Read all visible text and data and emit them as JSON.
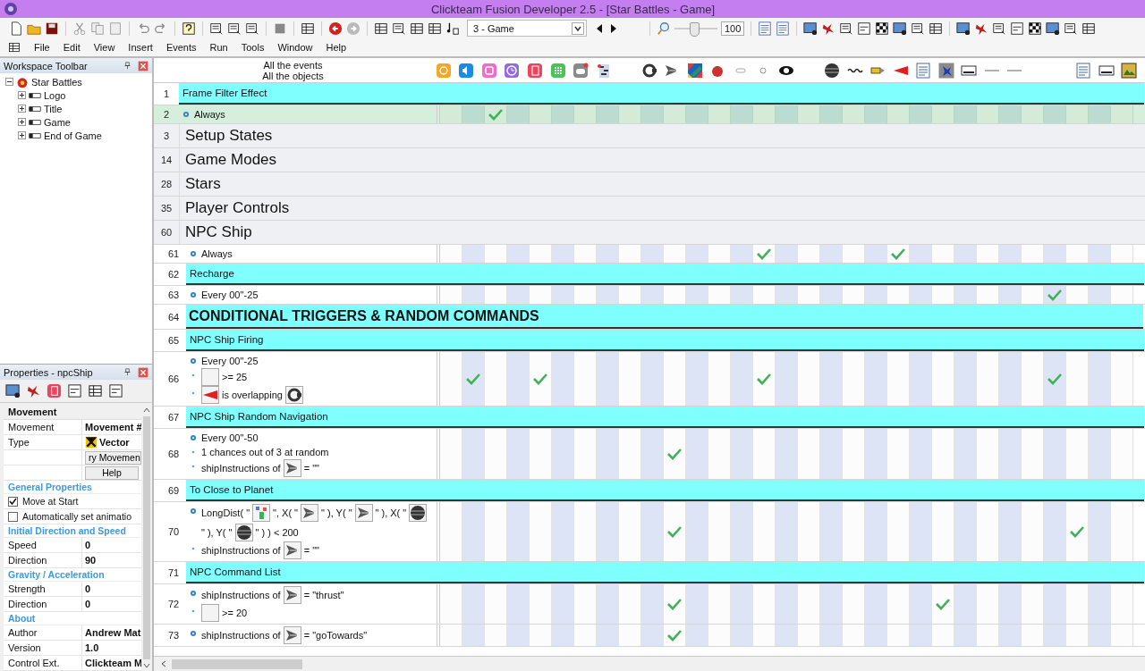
{
  "window": {
    "title": "Clickteam Fusion Developer 2.5 - [Star Battles - Game]"
  },
  "toolbar": {
    "frame_select": "3 - Game",
    "zoom_slider": {
      "level": 0.45
    },
    "zoom_value": "100"
  },
  "menu": [
    "File",
    "Edit",
    "View",
    "Insert",
    "Events",
    "Run",
    "Tools",
    "Window",
    "Help"
  ],
  "workspace": {
    "title": "Workspace Toolbar",
    "tree": [
      {
        "label": "Star Battles",
        "expanded": true,
        "children": [
          {
            "label": "Logo",
            "expanded": false
          },
          {
            "label": "Title",
            "expanded": false
          },
          {
            "label": "Game",
            "expanded": false
          },
          {
            "label": "End of Game",
            "expanded": false
          }
        ]
      }
    ]
  },
  "properties": {
    "title": "Properties - npcShip",
    "rows": [
      {
        "kind": "category",
        "name": "Movement"
      },
      {
        "kind": "prop",
        "name": "Movement",
        "value": "Movement #"
      },
      {
        "kind": "prop_icon",
        "name": "Type",
        "value": "Vector"
      },
      {
        "kind": "button",
        "value": "ry Movemen"
      },
      {
        "kind": "button",
        "value": "Help"
      },
      {
        "kind": "heading",
        "name": "General Properties"
      },
      {
        "kind": "checkbox",
        "name": "Move at Start",
        "checked": true
      },
      {
        "kind": "checkbox",
        "name": "Automatically set animatio",
        "checked": false
      },
      {
        "kind": "heading",
        "name": "Initial Direction and Speed"
      },
      {
        "kind": "prop",
        "name": "Speed",
        "value": "0"
      },
      {
        "kind": "prop",
        "name": "Direction",
        "value": "90"
      },
      {
        "kind": "heading",
        "name": "Gravity / Acceleration"
      },
      {
        "kind": "prop",
        "name": "Strength",
        "value": "0"
      },
      {
        "kind": "prop",
        "name": "Direction",
        "value": "0"
      },
      {
        "kind": "heading",
        "name": "About"
      },
      {
        "kind": "prop",
        "name": "Author",
        "value": "Andrew Mat"
      },
      {
        "kind": "prop",
        "name": "Version",
        "value": "1.0"
      },
      {
        "kind": "prop",
        "name": "Control Ext.",
        "value": "Clickteam M"
      }
    ]
  },
  "editor": {
    "header": [
      "All the events",
      "All the objects"
    ],
    "rows": [
      {
        "kind": "group",
        "number": "1",
        "title": "Frame Filter Effect",
        "selected": false
      },
      {
        "kind": "event",
        "number": "2",
        "selected": true,
        "conditions": [
          {
            "parts": [
              {
                "kind": "text",
                "text": "Always"
              }
            ]
          }
        ],
        "checked": [
          false,
          false,
          true,
          false,
          false,
          false,
          false,
          false,
          false,
          false,
          false,
          false,
          false,
          false,
          false,
          false,
          false,
          false,
          false,
          false,
          false,
          false,
          false,
          false,
          false,
          false,
          false,
          false,
          false,
          false,
          false
        ]
      },
      {
        "kind": "section",
        "number": "3",
        "title": "Setup States",
        "selected": false
      },
      {
        "kind": "section",
        "number": "14",
        "title": "Game Modes",
        "selected": false
      },
      {
        "kind": "section",
        "number": "28",
        "title": "Stars",
        "selected": false
      },
      {
        "kind": "section",
        "number": "35",
        "title": "Player Controls",
        "selected": false
      },
      {
        "kind": "section",
        "number": "60",
        "title": "NPC Ship",
        "selected": false,
        "children": [
          {
            "kind": "event",
            "number": "61",
            "selected": false,
            "conditions": [
              {
                "parts": [
                  {
                    "kind": "text",
                    "text": "Always"
                  }
                ]
              }
            ],
            "checked": [
              false,
              false,
              false,
              false,
              false,
              false,
              false,
              false,
              false,
              false,
              false,
              false,
              false,
              false,
              true,
              false,
              false,
              false,
              false,
              false,
              true,
              false,
              false,
              false,
              false,
              false,
              false,
              false,
              false,
              false,
              false
            ]
          },
          {
            "kind": "group",
            "number": "62",
            "title": "Recharge",
            "selected": false
          },
          {
            "kind": "event",
            "number": "63",
            "selected": false,
            "conditions": [
              {
                "parts": [
                  {
                    "kind": "text",
                    "text": "Every 00''-25"
                  }
                ]
              }
            ],
            "checked": [
              false,
              false,
              false,
              false,
              false,
              false,
              false,
              false,
              false,
              false,
              false,
              false,
              false,
              false,
              false,
              false,
              false,
              false,
              false,
              false,
              false,
              false,
              false,
              false,
              false,
              false,
              false,
              true,
              false,
              false,
              false
            ]
          },
          {
            "kind": "title",
            "number": "64",
            "title": "CONDITIONAL TRIGGERS & RANDOM COMMANDS",
            "selected": false
          },
          {
            "kind": "group",
            "number": "65",
            "title": "NPC Ship Firing",
            "selected": false
          },
          {
            "kind": "event",
            "number": "66",
            "selected": false,
            "conditions": [
              {
                "parts": [
                  {
                    "kind": "text",
                    "text": "Every 00''-25"
                  }
                ]
              },
              {
                "parts": [
                  {
                    "kind": "blank"
                  },
                  {
                    "kind": "text",
                    "text": ">= 25"
                  }
                ]
              },
              {
                "parts": [
                  {
                    "kind": "cone"
                  },
                  {
                    "kind": "text",
                    "text": "is overlapping"
                  },
                  {
                    "kind": "ring"
                  }
                ]
              }
            ],
            "checked": [
              false,
              true,
              false,
              false,
              true,
              false,
              false,
              false,
              false,
              false,
              false,
              false,
              false,
              false,
              true,
              false,
              false,
              false,
              false,
              false,
              false,
              false,
              false,
              false,
              false,
              false,
              false,
              true,
              false,
              false,
              false
            ]
          },
          {
            "kind": "group",
            "number": "67",
            "title": "NPC Ship Random Navigation",
            "selected": false
          },
          {
            "kind": "event",
            "number": "68",
            "selected": false,
            "conditions": [
              {
                "parts": [
                  {
                    "kind": "text",
                    "text": "Every 00''-50"
                  }
                ]
              },
              {
                "parts": [
                  {
                    "kind": "text",
                    "text": "1 chances out of 3 at random"
                  }
                ]
              },
              {
                "parts": [
                  {
                    "kind": "text",
                    "text": "shipInstructions of"
                  },
                  {
                    "kind": "ship"
                  },
                  {
                    "kind": "text",
                    "text": "= \"\""
                  }
                ]
              }
            ],
            "checked": [
              false,
              false,
              false,
              false,
              false,
              false,
              false,
              false,
              false,
              false,
              true,
              false,
              false,
              false,
              false,
              false,
              false,
              false,
              false,
              false,
              false,
              false,
              false,
              false,
              false,
              false,
              false,
              false,
              false,
              false,
              false
            ]
          },
          {
            "kind": "group",
            "number": "69",
            "title": "To Close to Planet",
            "selected": false
          },
          {
            "kind": "event",
            "number": "70",
            "selected": false,
            "conditions": [
              {
                "parts": [
                  {
                    "kind": "text",
                    "text": "LongDist( \""
                  },
                  {
                    "kind": "sprite"
                  },
                  {
                    "kind": "text",
                    "text": "\", X( \""
                  },
                  {
                    "kind": "ship"
                  },
                  {
                    "kind": "text",
                    "text": "\" ), Y( \""
                  },
                  {
                    "kind": "ship"
                  },
                  {
                    "kind": "text",
                    "text": "\" ), X( \""
                  },
                  {
                    "kind": "planet"
                  },
                  {
                    "kind": "text",
                    "text": "\" ), Y( \""
                  },
                  {
                    "kind": "planet"
                  },
                  {
                    "kind": "text",
                    "text": "\" ) ) < 200"
                  }
                ]
              },
              {
                "parts": [
                  {
                    "kind": "text",
                    "text": "shipInstructions of"
                  },
                  {
                    "kind": "ship"
                  },
                  {
                    "kind": "text",
                    "text": "= \"\""
                  }
                ]
              }
            ],
            "checked": [
              false,
              false,
              false,
              false,
              false,
              false,
              false,
              false,
              false,
              false,
              true,
              false,
              false,
              false,
              false,
              false,
              false,
              false,
              false,
              false,
              false,
              false,
              false,
              false,
              false,
              false,
              false,
              false,
              true,
              false,
              false
            ]
          },
          {
            "kind": "group",
            "number": "71",
            "title": "NPC Command List",
            "selected": false
          },
          {
            "kind": "event",
            "number": "72",
            "selected": false,
            "conditions": [
              {
                "parts": [
                  {
                    "kind": "text",
                    "text": "shipInstructions of"
                  },
                  {
                    "kind": "ship"
                  },
                  {
                    "kind": "text",
                    "text": "= \"thrust\""
                  }
                ]
              },
              {
                "parts": [
                  {
                    "kind": "blank"
                  },
                  {
                    "kind": "text",
                    "text": ">= 20"
                  }
                ]
              }
            ],
            "checked": [
              false,
              false,
              false,
              false,
              false,
              false,
              false,
              false,
              false,
              false,
              true,
              false,
              false,
              false,
              false,
              false,
              false,
              false,
              false,
              false,
              false,
              false,
              true,
              false,
              false,
              false,
              false,
              false,
              false,
              false,
              false
            ]
          },
          {
            "kind": "event",
            "number": "73",
            "selected": false,
            "conditions": [
              {
                "parts": [
                  {
                    "kind": "text",
                    "text": "shipInstructions of"
                  },
                  {
                    "kind": "ship"
                  },
                  {
                    "kind": "text",
                    "text": "= \"goTowards\""
                  }
                ]
              }
            ],
            "checked": [
              false,
              false,
              false,
              false,
              false,
              false,
              false,
              false,
              false,
              false,
              true,
              false,
              false,
              false,
              false,
              false,
              false,
              false,
              false,
              false,
              false,
              false,
              false,
              false,
              false,
              false,
              false,
              false,
              false,
              false,
              false
            ]
          }
        ]
      }
    ]
  }
}
